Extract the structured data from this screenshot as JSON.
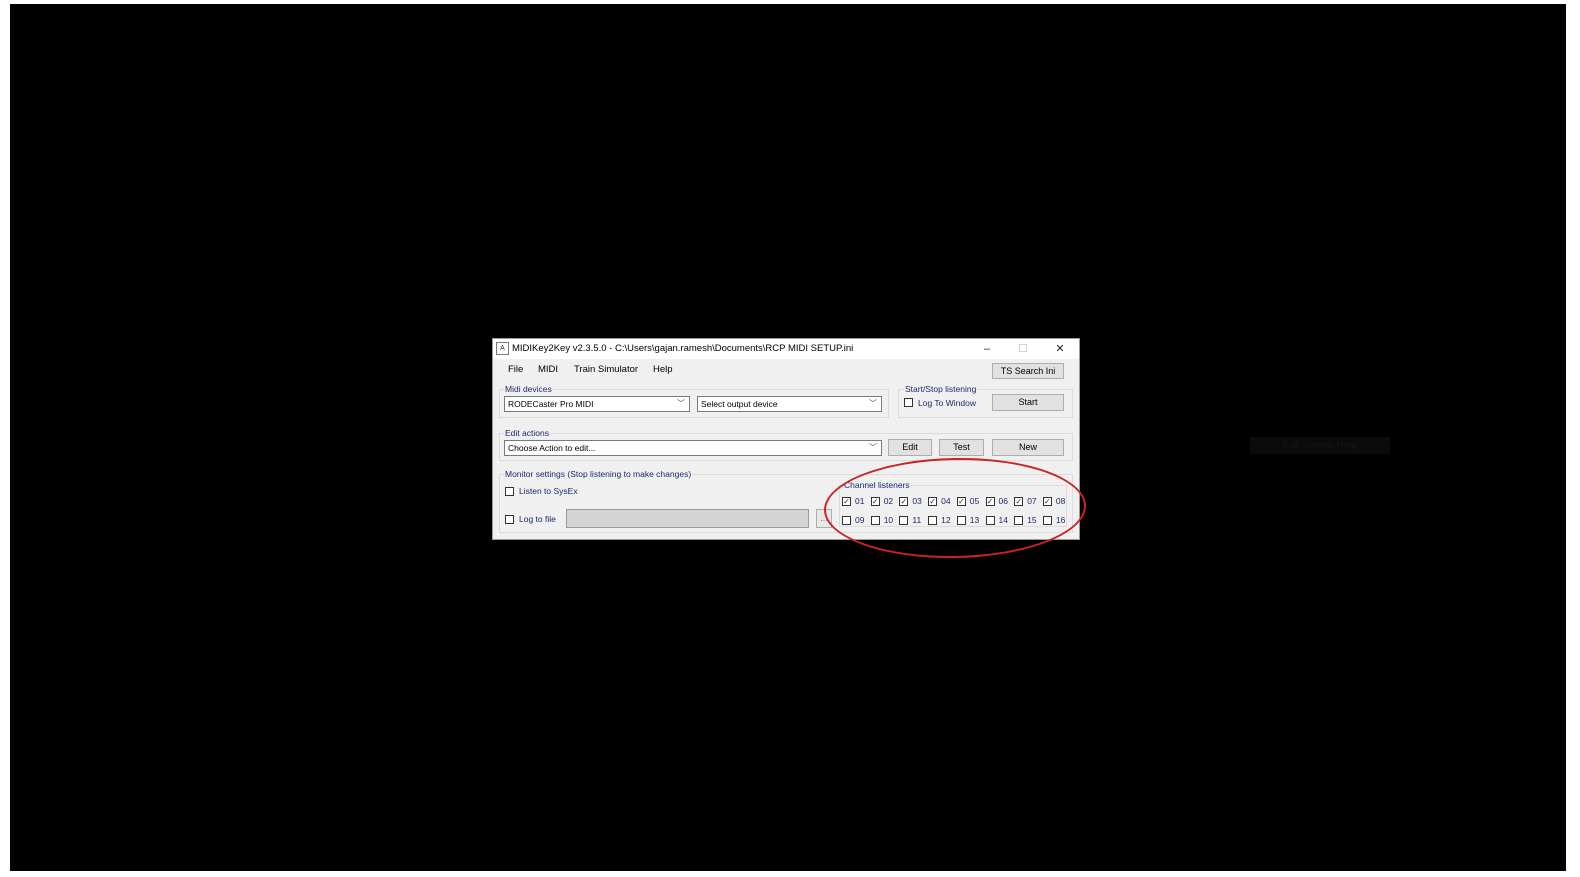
{
  "background_label": "Full Screen Help",
  "window": {
    "icon_glyph": "A",
    "title": "MIDIKey2Key v2.3.5.0 - C:\\Users\\gajan.ramesh\\Documents\\RCP MIDI SETUP.ini",
    "controls": {
      "minimize": "–",
      "maximize": "☐",
      "close": "✕"
    }
  },
  "menu": {
    "file": "File",
    "midi": "MIDI",
    "train_simulator": "Train Simulator",
    "help": "Help"
  },
  "ts_search_button": "TS Search Ini",
  "midi_devices": {
    "title": "Midi devices",
    "input_value": "RODECaster Pro MIDI",
    "output_value": "Select output device"
  },
  "start_stop": {
    "title": "Start/Stop listening",
    "log_to_window": {
      "label": "Log To Window",
      "checked": false
    },
    "start_button": "Start"
  },
  "edit_actions": {
    "title": "Edit actions",
    "combo_value": "Choose Action to edit...",
    "edit_button": "Edit",
    "test_button": "Test",
    "new_button": "New"
  },
  "monitor": {
    "title": "Monitor settings (Stop listening to make changes)",
    "listen_sysex": {
      "label": "Listen to SysEx",
      "checked": false
    },
    "log_to_file": {
      "label": "Log to file",
      "checked": false
    },
    "browse_button": "..."
  },
  "channel_listeners": {
    "title": "Channel listeners",
    "row1": [
      {
        "label": "01",
        "checked": true
      },
      {
        "label": "02",
        "checked": true
      },
      {
        "label": "03",
        "checked": true
      },
      {
        "label": "04",
        "checked": true
      },
      {
        "label": "05",
        "checked": true
      },
      {
        "label": "06",
        "checked": true
      },
      {
        "label": "07",
        "checked": true
      },
      {
        "label": "08",
        "checked": true
      }
    ],
    "row2": [
      {
        "label": "09",
        "checked": false
      },
      {
        "label": "10",
        "checked": false
      },
      {
        "label": "11",
        "checked": false
      },
      {
        "label": "12",
        "checked": false
      },
      {
        "label": "13",
        "checked": false
      },
      {
        "label": "14",
        "checked": false
      },
      {
        "label": "15",
        "checked": false
      },
      {
        "label": "16",
        "checked": false
      }
    ]
  },
  "colors": {
    "annotation_ellipse": "#cc2226",
    "group_title": "#1a2a6c",
    "backdrop": "#000000"
  }
}
